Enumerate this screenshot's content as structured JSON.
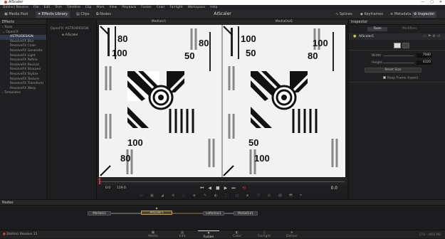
{
  "window": {
    "title": "AIScaler",
    "controls": [
      "—",
      "▢",
      "✕"
    ]
  },
  "menu": [
    "DaVinci Resolve",
    "File",
    "Edit",
    "Trim",
    "Timeline",
    "Clip",
    "Mark",
    "View",
    "Playback",
    "Fusion",
    "Color",
    "Fairlight",
    "Workspace",
    "Help"
  ],
  "toolbar": {
    "media_pool": "Media Pool",
    "effects_library": "Effects Library",
    "clips": "Clips",
    "nodes": "Nodes",
    "app_title": "AIScaler",
    "splines": "Splines",
    "keyframes": "Keyframes",
    "metadata": "Metadata",
    "inspector": "Inspector"
  },
  "effects": {
    "header": "Effects",
    "tree": [
      "Tools",
      "OpenFX",
      "ASTRODESIGN",
      "ResolveFX Blur",
      "ResolveFX Color",
      "ResolveFX Generate",
      "ResolveFX Light",
      "ResolveFX Refine",
      "ResolveFX Revival",
      "ResolveFX Sharpen",
      "ResolveFX Stylize",
      "ResolveFX Texture",
      "ResolveFX Transform",
      "ResolveFX Warp",
      "Templates"
    ]
  },
  "library": {
    "path": "OpenFX: ASTRODESIGN",
    "item": "AIScaler"
  },
  "viewer": {
    "left_label": "MediaIn1",
    "right_label": "MediaOut1",
    "timecode_start": "0.0",
    "timecode_end": "119.0",
    "current_time": "0.0",
    "chart_numbers": [
      "80",
      "100",
      "50",
      "80",
      "100",
      "50",
      "80",
      "100",
      "100",
      "80",
      "50",
      "100"
    ]
  },
  "inspector": {
    "header": "Inspector",
    "tab_tools": "Tools",
    "tab_modifiers": "Modifiers",
    "node_name": "AIScaler1",
    "width_label": "Width",
    "width_value": "7680",
    "height_label": "Height",
    "height_value": "4320",
    "reset_button": "Reset Size",
    "keep_aspect": "Keep Frame Aspect"
  },
  "nodes": {
    "header": "Nodes",
    "items": [
      "MediaIn1",
      "AIScaler1",
      "Letterbox1",
      "MediaOut1"
    ]
  },
  "pages": [
    "Media",
    "Edit",
    "Fusion",
    "Color",
    "Fairlight",
    "Deliver"
  ],
  "status": {
    "app_name": "DaVinci Resolve 15",
    "right_info": "27% - 4692 MB"
  }
}
